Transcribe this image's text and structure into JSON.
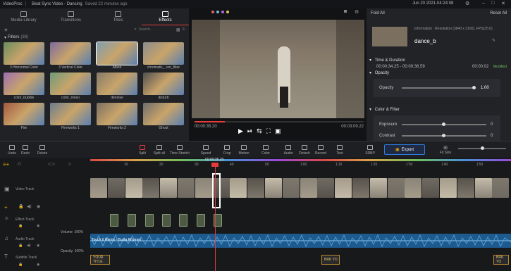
{
  "titlebar": {
    "app": "VideoProc",
    "project": "Beat Sync Video - Dancing",
    "saved": "Saved 22 minutes ago",
    "datetime": "Jun 20 2021-04:24:08"
  },
  "left": {
    "tabs": [
      {
        "label": "Media Library"
      },
      {
        "label": "Transitions"
      },
      {
        "label": "Titles"
      },
      {
        "label": "Effects"
      }
    ],
    "search_placeholder": "Search...",
    "filters_label": "Filters",
    "filters_count": "(38)",
    "filters": [
      {
        "label": "3 Horizontal Color",
        "color": "#6a8c5f"
      },
      {
        "label": "3 Vertical Color",
        "color": "#7d6a9c"
      },
      {
        "label": "Albeo",
        "color": "#7f9eb0"
      },
      {
        "label": "chromatic_..ion_filter",
        "color": "#8c8c8c"
      },
      {
        "label": "color_bubble",
        "color": "#9a6fb0"
      },
      {
        "label": "color_meso",
        "color": "#6f9a7a"
      },
      {
        "label": "denoise",
        "color": "#857a6a"
      },
      {
        "label": "disturb",
        "color": "#505050"
      },
      {
        "label": "Fire",
        "color": "#a3583e"
      },
      {
        "label": "Fireworks 1",
        "color": "#6b7c8e"
      },
      {
        "label": "Fireworks 2",
        "color": "#7a6f62"
      },
      {
        "label": "Ghost",
        "color": "#6d6d6d"
      }
    ]
  },
  "preview": {
    "time_current": "00:00:35.20",
    "time_total": "00:03:09.22"
  },
  "right": {
    "fold_all": "Fold All",
    "reset_all": "Reset All",
    "info": "Information : Resolution (3840 x 2160), FPS(25.0)",
    "clip_name": "dance_b",
    "time_duration_label": "Time & Duration",
    "time_range": "00:00:34.25 - 00:00:36.59",
    "duration": "00:00:02",
    "modified": "Modified",
    "opacity_section": "Opacity",
    "opacity_label": "Opacity",
    "opacity_value": "1.00",
    "opacity_level": 1.0,
    "color_filter_section": "Color & Filter",
    "exposure_label": "Exposure",
    "exposure_value": "0",
    "contrast_label": "Contrast",
    "contrast_value": "0"
  },
  "toolbar": {
    "tools": [
      "Undo",
      "Redo",
      "Delete",
      "Split",
      "Split all",
      "Time Stretch",
      "Speed",
      "Crop",
      "Motion",
      "Color",
      "Audio",
      "Detach",
      "Record",
      "Text",
      "SRBP"
    ],
    "export": "Export",
    "fit_size": "Fit Size"
  },
  "timeline": {
    "playhead": "00:00:35.20",
    "ruler": [
      "10",
      "20",
      "30",
      "40",
      "50",
      "1'00",
      "1'10",
      "1'20",
      "1'30",
      "1'40",
      "1'50"
    ],
    "tracks": [
      "Video Track",
      "Effect Track",
      "Audio Track",
      "Subtitle Track"
    ],
    "volume_label": "Volume: 100%",
    "opacity_label": "Opacity: 100%",
    "audio_clip": "Touch It Remix - Busta Rhymes",
    "subtitle_1": "YOUR TITLE",
    "subtitle_2": "BRK YO",
    "subtitle_3": "BRK YO"
  }
}
